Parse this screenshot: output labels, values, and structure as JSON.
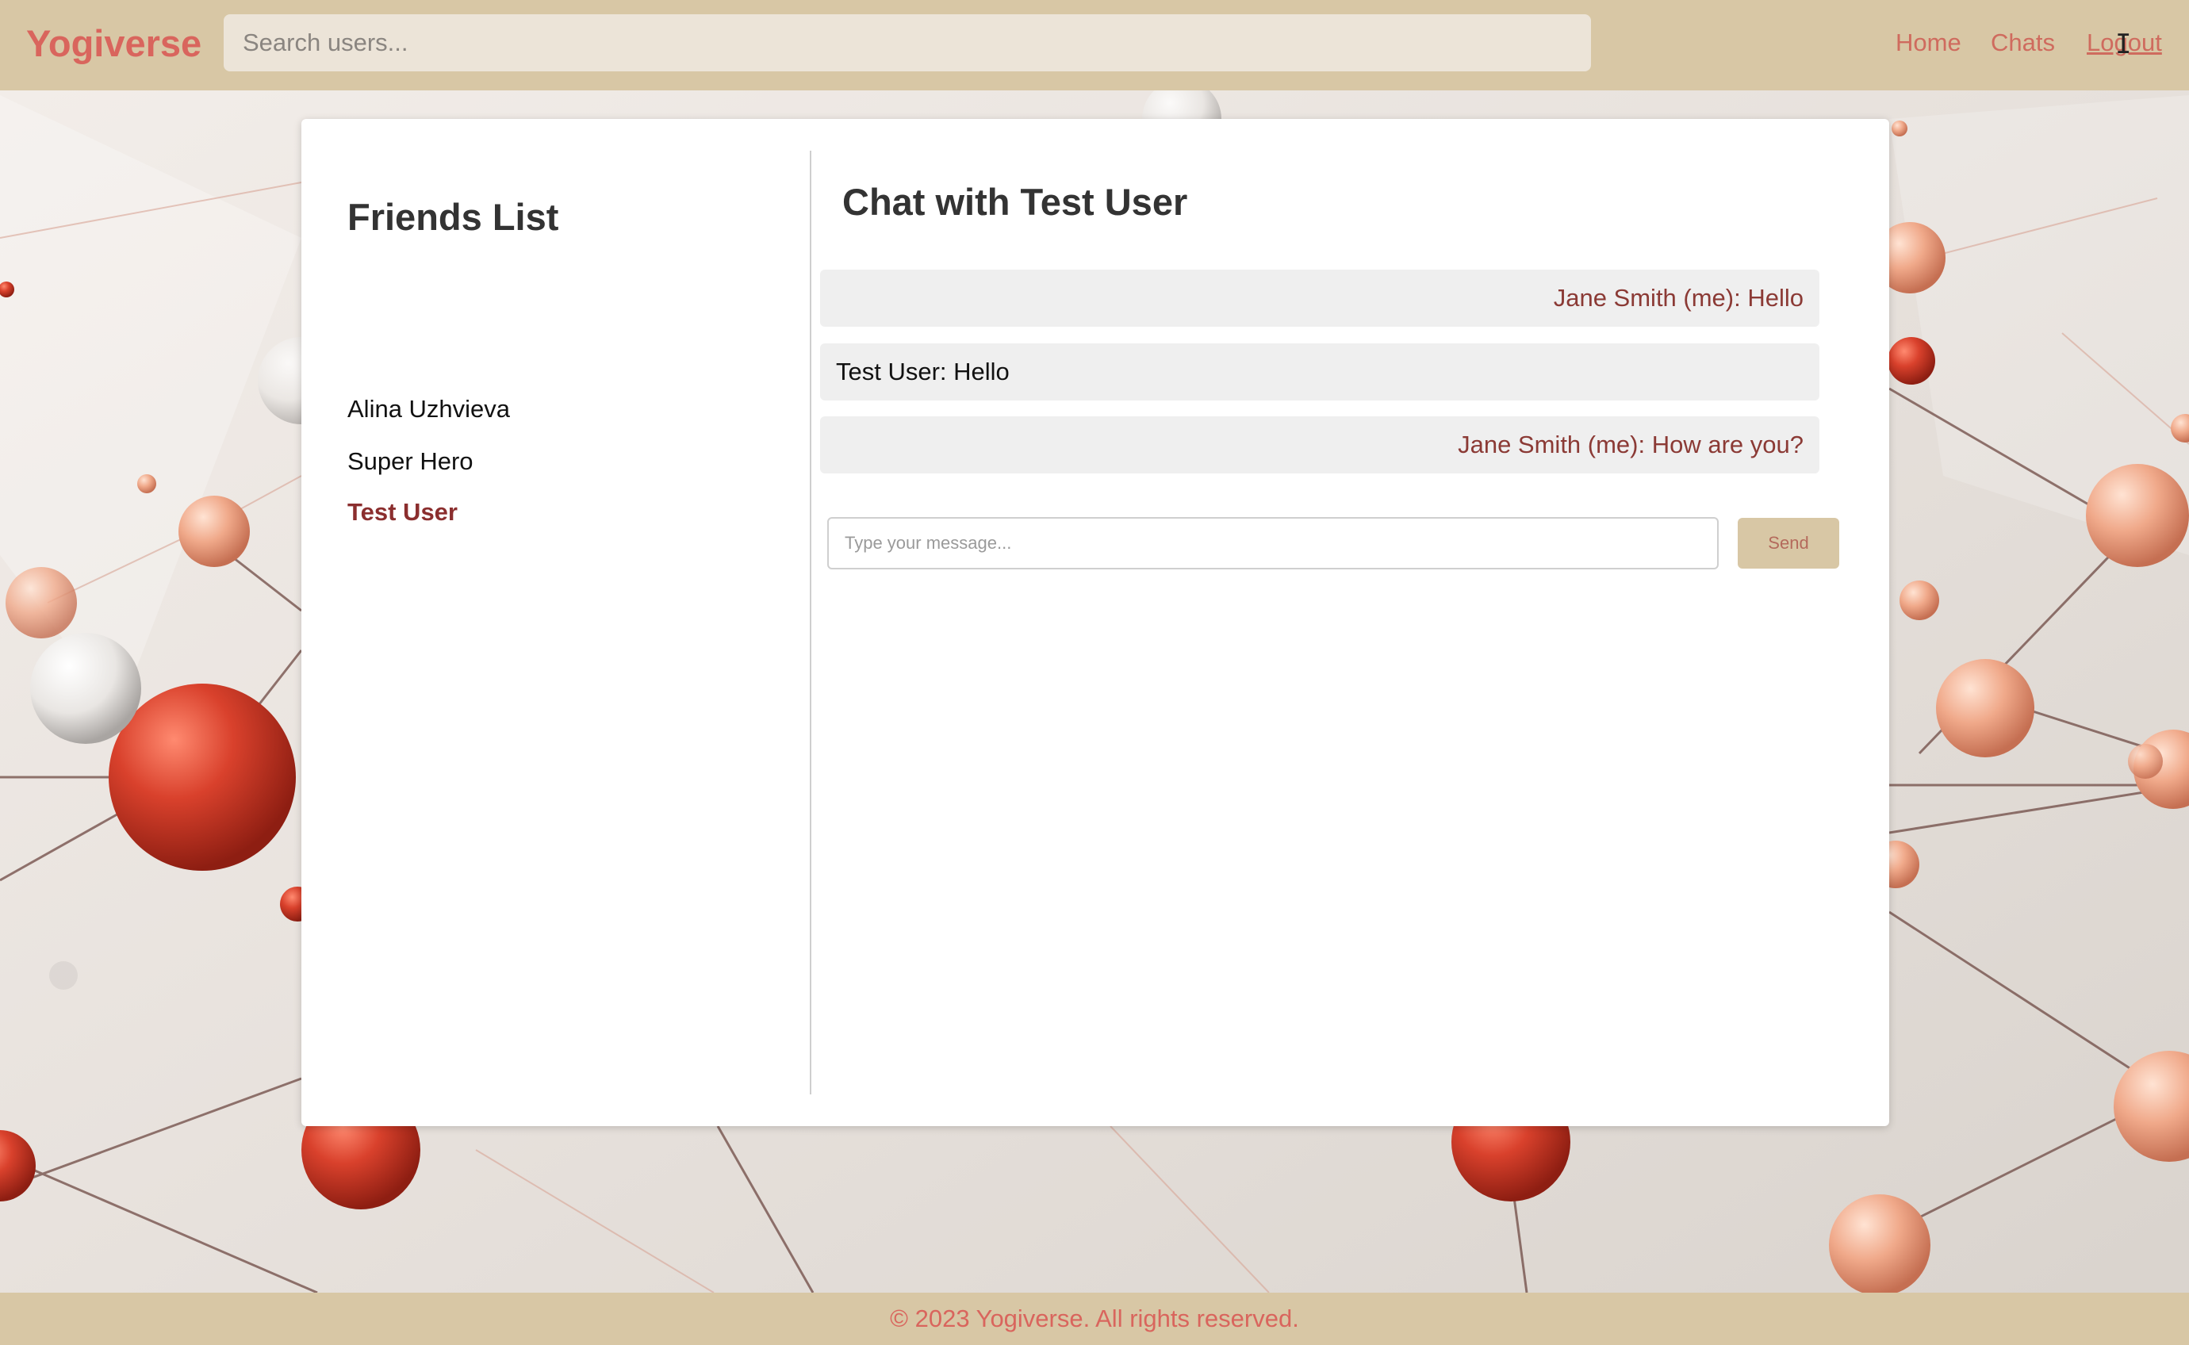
{
  "header": {
    "brand": "Yogiverse",
    "search_placeholder": "Search users...",
    "nav": {
      "home": "Home",
      "chats": "Chats",
      "logout": "Logout"
    }
  },
  "friends": {
    "title": "Friends List",
    "items": [
      {
        "label": "Alina Uzhvieva",
        "active": false
      },
      {
        "label": "Super Hero",
        "active": false
      },
      {
        "label": "Test User",
        "active": true
      }
    ]
  },
  "chat": {
    "title": "Chat with Test User",
    "messages": [
      {
        "text": "Jane Smith (me): Hello",
        "from_me": true
      },
      {
        "text": "Test User: Hello",
        "from_me": false
      },
      {
        "text": "Jane Smith (me): How are you?",
        "from_me": true
      }
    ],
    "input_placeholder": "Type your message...",
    "input_value": "",
    "send_label": "Send"
  },
  "footer": {
    "text": "© 2023 Yogiverse. All rights reserved."
  },
  "colors": {
    "bar": "#d8c7a5",
    "brand": "#d9655d",
    "nav_link": "#cf6b5e",
    "active_friend": "#8b2e2e",
    "own_message": "#8b3a35",
    "message_bg": "#efefef"
  },
  "icons": {
    "cursor": "text-cursor-icon"
  }
}
